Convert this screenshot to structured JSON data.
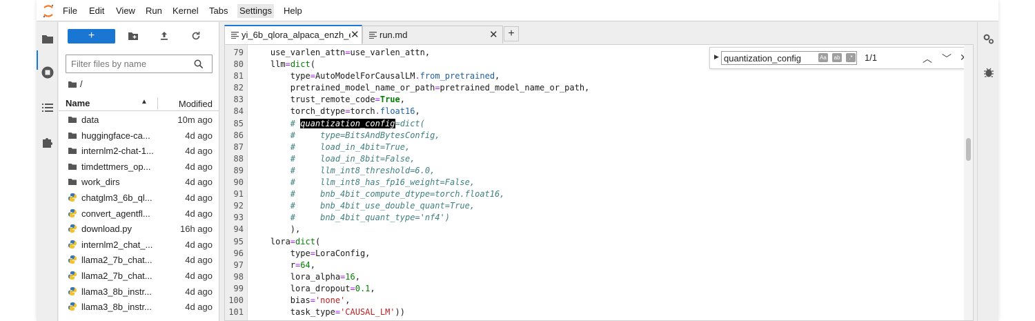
{
  "menubar": {
    "items": [
      "File",
      "Edit",
      "View",
      "Run",
      "Kernel",
      "Tabs",
      "Settings",
      "Help"
    ],
    "active_index": 6
  },
  "leftbar": {
    "icons": [
      "folder-icon",
      "running-icon",
      "toc-icon",
      "extension-icon"
    ]
  },
  "file_browser": {
    "new_label": "+",
    "filter_placeholder": "Filter files by name",
    "breadcrumb": "/",
    "columns": {
      "name": "Name",
      "modified": "Modified"
    },
    "files": [
      {
        "name": "data",
        "modified": "10m ago",
        "type": "folder"
      },
      {
        "name": "huggingface-ca...",
        "modified": "4d ago",
        "type": "folder"
      },
      {
        "name": "internlm2-chat-1...",
        "modified": "4d ago",
        "type": "folder"
      },
      {
        "name": "timdettmers_op...",
        "modified": "4d ago",
        "type": "folder"
      },
      {
        "name": "work_dirs",
        "modified": "4d ago",
        "type": "folder"
      },
      {
        "name": "chatglm3_6b_ql...",
        "modified": "4d ago",
        "type": "python"
      },
      {
        "name": "convert_agentfl...",
        "modified": "4d ago",
        "type": "python"
      },
      {
        "name": "download.py",
        "modified": "16h ago",
        "type": "python"
      },
      {
        "name": "internlm2_chat_...",
        "modified": "4d ago",
        "type": "python"
      },
      {
        "name": "llama2_7b_chat...",
        "modified": "4d ago",
        "type": "python"
      },
      {
        "name": "llama2_7b_chat...",
        "modified": "4d ago",
        "type": "python"
      },
      {
        "name": "llama3_8b_instr...",
        "modified": "4d ago",
        "type": "python"
      },
      {
        "name": "llama3_8b_instr...",
        "modified": "4d ago",
        "type": "python"
      }
    ]
  },
  "tabs": [
    {
      "label": "yi_6b_qlora_alpaca_enzh_e",
      "active": true
    },
    {
      "label": "run.md",
      "active": false
    }
  ],
  "find": {
    "query": "quantization_config",
    "count": "1/1",
    "options": [
      "Aa",
      "ab",
      ".*"
    ]
  },
  "editor": {
    "lines": [
      {
        "n": "79",
        "tokens": [
          [
            "",
            "    use_varlen_attn"
          ],
          [
            "op",
            "="
          ],
          [
            "",
            "use_varlen_attn,"
          ]
        ]
      },
      {
        "n": "80",
        "tokens": [
          [
            "",
            "    llm"
          ],
          [
            "op",
            "="
          ],
          [
            "builtin",
            "dict"
          ],
          [
            "",
            "("
          ]
        ]
      },
      {
        "n": "81",
        "tokens": [
          [
            "",
            "        type"
          ],
          [
            "op",
            "="
          ],
          [
            "",
            "AutoModelForCausalLM"
          ],
          [
            "op",
            "."
          ],
          [
            "attr",
            "from_pretrained"
          ],
          [
            "",
            ","
          ]
        ]
      },
      {
        "n": "82",
        "tokens": [
          [
            "",
            "        pretrained_model_name_or_path"
          ],
          [
            "op",
            "="
          ],
          [
            "",
            "pretrained_model_name_or_path,"
          ]
        ]
      },
      {
        "n": "83",
        "tokens": [
          [
            "",
            "        trust_remote_code"
          ],
          [
            "op",
            "="
          ],
          [
            "kw",
            "True"
          ],
          [
            "",
            ","
          ]
        ]
      },
      {
        "n": "84",
        "tokens": [
          [
            "",
            "        torch_dtype"
          ],
          [
            "op",
            "="
          ],
          [
            "",
            "torch"
          ],
          [
            "op",
            "."
          ],
          [
            "attr",
            "float16"
          ],
          [
            "",
            ","
          ]
        ]
      },
      {
        "n": "85",
        "tokens": [
          [
            "com",
            "        # "
          ],
          [
            "hl",
            "quantization_config"
          ],
          [
            "com",
            "=dict("
          ]
        ]
      },
      {
        "n": "86",
        "tokens": [
          [
            "com",
            "        #     type=BitsAndBytesConfig,"
          ]
        ]
      },
      {
        "n": "87",
        "tokens": [
          [
            "com",
            "        #     load_in_4bit=True,"
          ]
        ]
      },
      {
        "n": "88",
        "tokens": [
          [
            "com",
            "        #     load_in_8bit=False,"
          ]
        ]
      },
      {
        "n": "89",
        "tokens": [
          [
            "com",
            "        #     llm_int8_threshold=6.0,"
          ]
        ]
      },
      {
        "n": "90",
        "tokens": [
          [
            "com",
            "        #     llm_int8_has_fp16_weight=False,"
          ]
        ]
      },
      {
        "n": "91",
        "tokens": [
          [
            "com",
            "        #     bnb_4bit_compute_dtype=torch.float16,"
          ]
        ]
      },
      {
        "n": "92",
        "tokens": [
          [
            "com",
            "        #     bnb_4bit_use_double_quant=True,"
          ]
        ]
      },
      {
        "n": "93",
        "tokens": [
          [
            "com",
            "        #     bnb_4bit_quant_type='nf4')"
          ]
        ]
      },
      {
        "n": "94",
        "tokens": [
          [
            "",
            "        ),"
          ]
        ]
      },
      {
        "n": "95",
        "tokens": [
          [
            "",
            "    lora"
          ],
          [
            "op",
            "="
          ],
          [
            "builtin",
            "dict"
          ],
          [
            "",
            "("
          ]
        ]
      },
      {
        "n": "96",
        "tokens": [
          [
            "",
            "        type"
          ],
          [
            "op",
            "="
          ],
          [
            "",
            "LoraConfig,"
          ]
        ]
      },
      {
        "n": "97",
        "tokens": [
          [
            "",
            "        r"
          ],
          [
            "op",
            "="
          ],
          [
            "num",
            "64"
          ],
          [
            "",
            ","
          ]
        ]
      },
      {
        "n": "98",
        "tokens": [
          [
            "",
            "        lora_alpha"
          ],
          [
            "op",
            "="
          ],
          [
            "num",
            "16"
          ],
          [
            "",
            ","
          ]
        ]
      },
      {
        "n": "99",
        "tokens": [
          [
            "",
            "        lora_dropout"
          ],
          [
            "op",
            "="
          ],
          [
            "num",
            "0.1"
          ],
          [
            "",
            ","
          ]
        ]
      },
      {
        "n": "100",
        "tokens": [
          [
            "",
            "        bias"
          ],
          [
            "op",
            "="
          ],
          [
            "str",
            "'none'"
          ],
          [
            "",
            ","
          ]
        ]
      },
      {
        "n": "101",
        "tokens": [
          [
            "",
            "        task_type"
          ],
          [
            "op",
            "="
          ],
          [
            "str",
            "'CAUSAL_LM'"
          ],
          [
            "",
            "))"
          ]
        ]
      }
    ]
  },
  "rightbar": {
    "icons": [
      "property-inspector-icon",
      "debugger-icon"
    ]
  },
  "colors": {
    "accent": "#1976d2",
    "highlight_bg": "#000000",
    "comment": "#408080",
    "string": "#ba2121",
    "number": "#008000"
  }
}
